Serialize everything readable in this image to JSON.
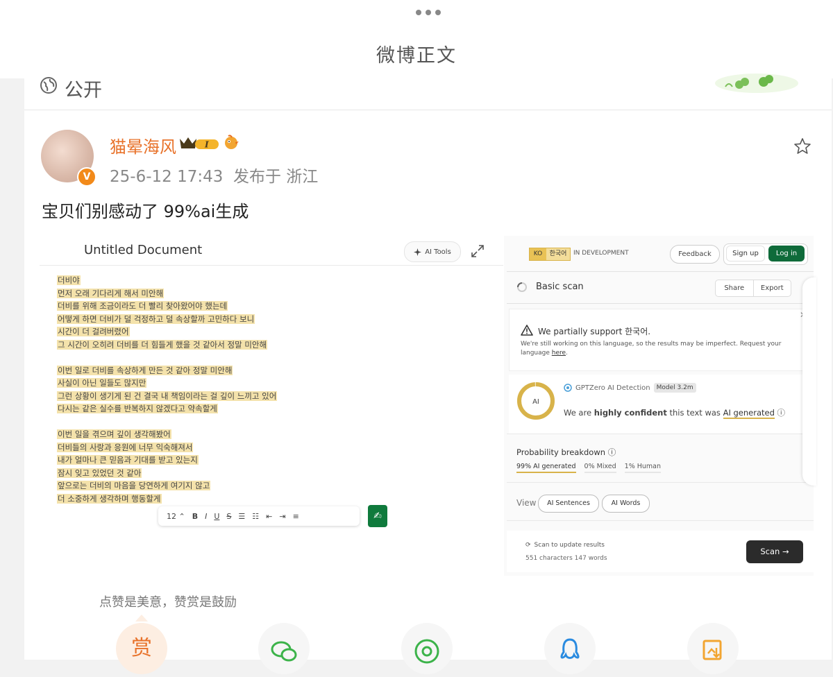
{
  "header": {
    "page_title": "微博正文"
  },
  "post": {
    "visibility": "公开",
    "username": "猫晕海风",
    "vip_level": "I",
    "verified_badge": "V",
    "timestamp": "25-6-12 17:43",
    "location": "发布于 浙江",
    "body": "宝贝们别感动了 99%ai生成"
  },
  "embedded_doc": {
    "title": "Untitled Document",
    "ai_tools_label": "AI Tools",
    "lines": [
      "더비야",
      "먼저 오래 기다리게 해서 미안해",
      "더비를 위해 조금이라도 더 빨리 찾아왔어야 했는데",
      "어떻게 하면 더비가 덜 걱정하고 덜 속상할까 고민하다 보니",
      "시간이 더 걸려버렸어",
      "그 시간이 오히려 더비를 더 힘들게 했을 것 같아서 정말 미안해",
      "",
      "이번 일로 더비를 속상하게 만든 것 같아 정말 미안해",
      "사실이 아닌 일들도 많지만",
      "그런 상황이 생기게 된 건 결국 내 책임이라는 걸 깊이 느끼고 있어",
      "다시는 같은 실수를 반복하지 않겠다고 약속할게",
      "",
      "이번 일을 겪으며 깊이 생각해봤어",
      "더비들의 사랑과 응원에 너무 익숙해져서",
      "내가 얼마나 큰 믿음과 기대를 받고 있는지",
      "잠시 잊고 있었던 것 같아",
      "앞으로는 더비의 마음을 당연하게 여기지 않고",
      "더 소중하게 생각하며 행동할게"
    ],
    "toolbar": {
      "font_size": "12",
      "bold": "B",
      "italic": "I",
      "underline": "U",
      "strike": "S"
    }
  },
  "gptzero": {
    "lang_code": "KO",
    "lang_name": "한국어",
    "dev_status": "IN DEVELOPMENT",
    "feedback": "Feedback",
    "sign_up": "Sign up",
    "log_in": "Log in",
    "scan_title": "Basic scan",
    "share": "Share",
    "export": "Export",
    "warning_title": "We partially support 한국어.",
    "warning_body": "We're still working on this language, so the results may be imperfect. Request your language",
    "warning_link": "here",
    "ring_label": "AI",
    "detector_name": "GPTZero AI Detection",
    "model": "Model 3.2m",
    "confidence_prefix": "We are",
    "confidence_strength": "highly confident",
    "confidence_mid": "this text was",
    "confidence_result": "AI generated",
    "prob_title": "Probability breakdown",
    "prob_ai": "99% AI generated",
    "prob_mixed": "0% Mixed",
    "prob_human": "1% Human",
    "ai_fraction": 0.99,
    "view_label": "View",
    "btn_sentences": "AI Sentences",
    "btn_words": "AI Words",
    "scan_update": "Scan to update results",
    "char_count": "551 characters 147 words",
    "scan_button": "Scan →"
  },
  "footer": {
    "like_text": "点赞是美意，赞赏是鼓励",
    "reward_label": "赏"
  },
  "colors": {
    "brand_orange": "#e8722a",
    "highlight": "#f4e2ab",
    "gptzero_green": "#0f6b3a",
    "ai_gold": "#d8b34a"
  }
}
